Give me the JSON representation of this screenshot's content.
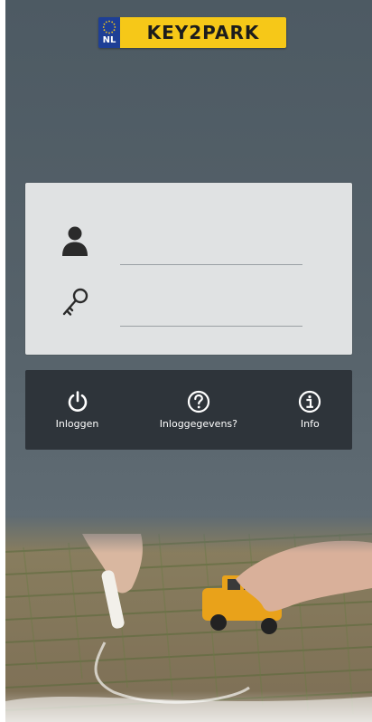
{
  "header": {
    "country_code": "NL",
    "brand": "KEY2PARK"
  },
  "login": {
    "username_value": "",
    "password_value": ""
  },
  "actions": {
    "login_label": "Inloggen",
    "credentials_label": "Inloggegevens?",
    "info_label": "Info"
  },
  "colors": {
    "plate_yellow": "#f6c818",
    "eu_blue": "#1e3f96",
    "background": "#56626a",
    "panel": "#e0e2e3",
    "action_bar": "#2e343a"
  },
  "icons": [
    "user-icon",
    "key-icon",
    "power-icon",
    "question-icon",
    "info-icon"
  ]
}
